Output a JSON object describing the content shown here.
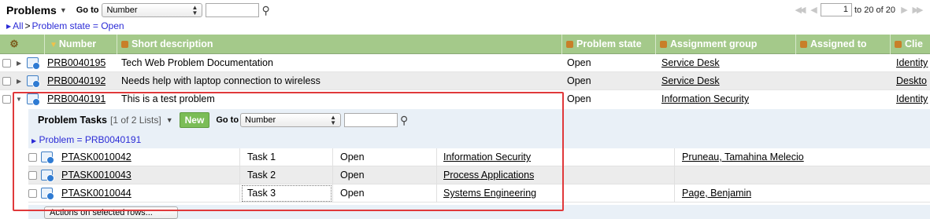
{
  "toolbar": {
    "title": "Problems",
    "goto_label": "Go to",
    "goto_field": "Number",
    "search_value": ""
  },
  "pager": {
    "current": "1",
    "range_text": "to 20 of 20"
  },
  "breadcrumb": {
    "all": "All",
    "separator": ">",
    "filter": "Problem state = Open"
  },
  "columns": [
    "Number",
    "Short description",
    "Problem state",
    "Assignment group",
    "Assigned to",
    "Clie"
  ],
  "rows": [
    {
      "number": "PRB0040195",
      "short_description": "Tech Web Problem Documentation",
      "state": "Open",
      "group": "Service Desk",
      "assigned_to": "",
      "ci": "Identity"
    },
    {
      "number": "PRB0040192",
      "short_description": "Needs help with laptop connection to wireless",
      "state": "Open",
      "group": "Service Desk",
      "assigned_to": "",
      "ci": "Deskto"
    },
    {
      "number": "PRB0040191",
      "short_description": "This is a test problem",
      "state": "Open",
      "group": "Information Security",
      "assigned_to": "",
      "ci": "Identity"
    }
  ],
  "related": {
    "title": "Problem Tasks",
    "count": "[1 of 2 Lists]",
    "new_label": "New",
    "goto_label": "Go to",
    "goto_field": "Number",
    "filter": "Problem = PRB0040191",
    "tasks": [
      {
        "number": "PTASK0010042",
        "description": "Task 1",
        "state": "Open",
        "group": "Information Security",
        "assigned_to": "Pruneau, Tamahina Melecio"
      },
      {
        "number": "PTASK0010043",
        "description": "Task 2",
        "state": "Open",
        "group": "Process Applications",
        "assigned_to": ""
      },
      {
        "number": "PTASK0010044",
        "description": "Task 3",
        "state": "Open",
        "group": "Systems Engineering",
        "assigned_to": "Page, Benjamin"
      }
    ],
    "actions_label": "Actions on selected rows..."
  },
  "colors": {
    "header_bg": "#a4c98a",
    "link": "#2b2bd6",
    "new_button": "#7bbd57",
    "highlight": "#e0393b",
    "related_bg": "#e9f0f7"
  }
}
